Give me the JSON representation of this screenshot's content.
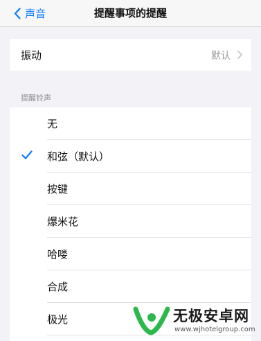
{
  "navbar": {
    "back_label": "声音",
    "title": "提醒事项的提醒"
  },
  "vibration": {
    "label": "振动",
    "value": "默认"
  },
  "tones_section": {
    "header": "提醒铃声",
    "items": [
      {
        "label": "无",
        "selected": false
      },
      {
        "label": "和弦（默认）",
        "selected": true
      },
      {
        "label": "按键",
        "selected": false
      },
      {
        "label": "爆米花",
        "selected": false
      },
      {
        "label": "哈喽",
        "selected": false
      },
      {
        "label": "合成",
        "selected": false
      },
      {
        "label": "极光",
        "selected": false
      }
    ]
  },
  "watermark": {
    "name": "无极安卓网",
    "url": "www.wjhotelgroup.com"
  },
  "colors": {
    "accent": "#0a7aff",
    "background": "#f2f2f7",
    "watermark_green": "#2db84d"
  }
}
